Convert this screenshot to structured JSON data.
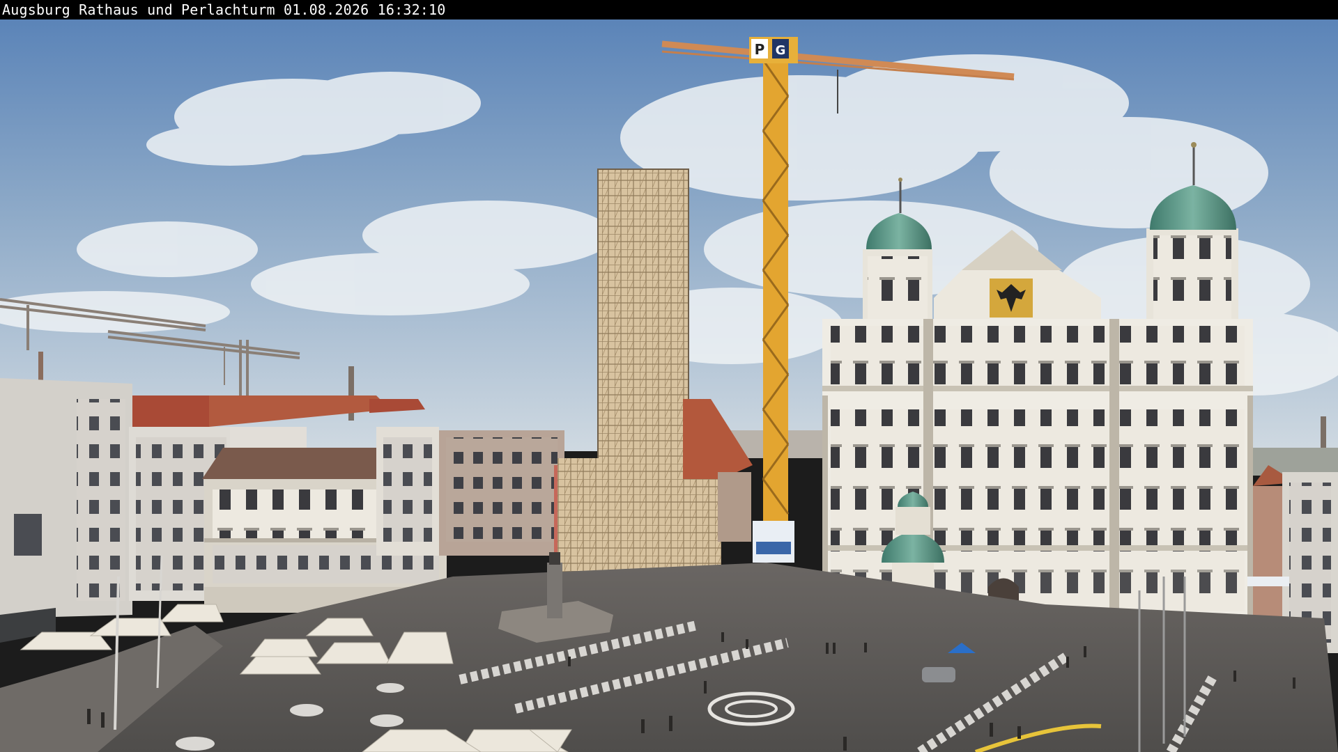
{
  "camera": {
    "caption": "Augsburg Rathaus und Perlachturm 01.08.2026 16:32:10"
  },
  "crane": {
    "sign_letter": "P",
    "sign_number": "G"
  },
  "colors": {
    "sky_top": "#5f86b8",
    "sky_bottom": "#c9d6e0",
    "cloud": "#e8edf2",
    "crane_yellow": "#e0a02a",
    "dome_green": "#5f9c8a",
    "facade": "#efece4",
    "plaza": "#5a5856",
    "scaffold": "#c8ad86",
    "roof_red": "#b05a3e"
  }
}
